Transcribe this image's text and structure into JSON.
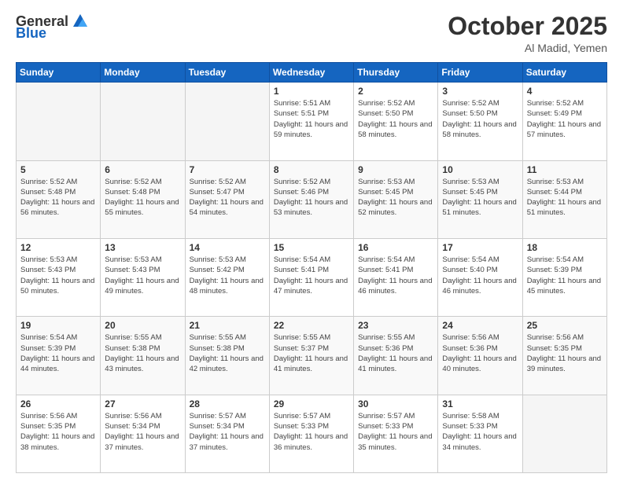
{
  "header": {
    "logo_general": "General",
    "logo_blue": "Blue",
    "month_title": "October 2025",
    "location": "Al Madid, Yemen"
  },
  "days_of_week": [
    "Sunday",
    "Monday",
    "Tuesday",
    "Wednesday",
    "Thursday",
    "Friday",
    "Saturday"
  ],
  "weeks": [
    [
      {
        "day": "",
        "empty": true
      },
      {
        "day": "",
        "empty": true
      },
      {
        "day": "",
        "empty": true
      },
      {
        "day": "1",
        "sunrise": "5:51 AM",
        "sunset": "5:51 PM",
        "daylight": "11 hours and 59 minutes."
      },
      {
        "day": "2",
        "sunrise": "5:52 AM",
        "sunset": "5:50 PM",
        "daylight": "11 hours and 58 minutes."
      },
      {
        "day": "3",
        "sunrise": "5:52 AM",
        "sunset": "5:50 PM",
        "daylight": "11 hours and 58 minutes."
      },
      {
        "day": "4",
        "sunrise": "5:52 AM",
        "sunset": "5:49 PM",
        "daylight": "11 hours and 57 minutes."
      }
    ],
    [
      {
        "day": "5",
        "sunrise": "5:52 AM",
        "sunset": "5:48 PM",
        "daylight": "11 hours and 56 minutes."
      },
      {
        "day": "6",
        "sunrise": "5:52 AM",
        "sunset": "5:48 PM",
        "daylight": "11 hours and 55 minutes."
      },
      {
        "day": "7",
        "sunrise": "5:52 AM",
        "sunset": "5:47 PM",
        "daylight": "11 hours and 54 minutes."
      },
      {
        "day": "8",
        "sunrise": "5:52 AM",
        "sunset": "5:46 PM",
        "daylight": "11 hours and 53 minutes."
      },
      {
        "day": "9",
        "sunrise": "5:53 AM",
        "sunset": "5:45 PM",
        "daylight": "11 hours and 52 minutes."
      },
      {
        "day": "10",
        "sunrise": "5:53 AM",
        "sunset": "5:45 PM",
        "daylight": "11 hours and 51 minutes."
      },
      {
        "day": "11",
        "sunrise": "5:53 AM",
        "sunset": "5:44 PM",
        "daylight": "11 hours and 51 minutes."
      }
    ],
    [
      {
        "day": "12",
        "sunrise": "5:53 AM",
        "sunset": "5:43 PM",
        "daylight": "11 hours and 50 minutes."
      },
      {
        "day": "13",
        "sunrise": "5:53 AM",
        "sunset": "5:43 PM",
        "daylight": "11 hours and 49 minutes."
      },
      {
        "day": "14",
        "sunrise": "5:53 AM",
        "sunset": "5:42 PM",
        "daylight": "11 hours and 48 minutes."
      },
      {
        "day": "15",
        "sunrise": "5:54 AM",
        "sunset": "5:41 PM",
        "daylight": "11 hours and 47 minutes."
      },
      {
        "day": "16",
        "sunrise": "5:54 AM",
        "sunset": "5:41 PM",
        "daylight": "11 hours and 46 minutes."
      },
      {
        "day": "17",
        "sunrise": "5:54 AM",
        "sunset": "5:40 PM",
        "daylight": "11 hours and 46 minutes."
      },
      {
        "day": "18",
        "sunrise": "5:54 AM",
        "sunset": "5:39 PM",
        "daylight": "11 hours and 45 minutes."
      }
    ],
    [
      {
        "day": "19",
        "sunrise": "5:54 AM",
        "sunset": "5:39 PM",
        "daylight": "11 hours and 44 minutes."
      },
      {
        "day": "20",
        "sunrise": "5:55 AM",
        "sunset": "5:38 PM",
        "daylight": "11 hours and 43 minutes."
      },
      {
        "day": "21",
        "sunrise": "5:55 AM",
        "sunset": "5:38 PM",
        "daylight": "11 hours and 42 minutes."
      },
      {
        "day": "22",
        "sunrise": "5:55 AM",
        "sunset": "5:37 PM",
        "daylight": "11 hours and 41 minutes."
      },
      {
        "day": "23",
        "sunrise": "5:55 AM",
        "sunset": "5:36 PM",
        "daylight": "11 hours and 41 minutes."
      },
      {
        "day": "24",
        "sunrise": "5:56 AM",
        "sunset": "5:36 PM",
        "daylight": "11 hours and 40 minutes."
      },
      {
        "day": "25",
        "sunrise": "5:56 AM",
        "sunset": "5:35 PM",
        "daylight": "11 hours and 39 minutes."
      }
    ],
    [
      {
        "day": "26",
        "sunrise": "5:56 AM",
        "sunset": "5:35 PM",
        "daylight": "11 hours and 38 minutes."
      },
      {
        "day": "27",
        "sunrise": "5:56 AM",
        "sunset": "5:34 PM",
        "daylight": "11 hours and 37 minutes."
      },
      {
        "day": "28",
        "sunrise": "5:57 AM",
        "sunset": "5:34 PM",
        "daylight": "11 hours and 37 minutes."
      },
      {
        "day": "29",
        "sunrise": "5:57 AM",
        "sunset": "5:33 PM",
        "daylight": "11 hours and 36 minutes."
      },
      {
        "day": "30",
        "sunrise": "5:57 AM",
        "sunset": "5:33 PM",
        "daylight": "11 hours and 35 minutes."
      },
      {
        "day": "31",
        "sunrise": "5:58 AM",
        "sunset": "5:33 PM",
        "daylight": "11 hours and 34 minutes."
      },
      {
        "day": "",
        "empty": true
      }
    ]
  ]
}
